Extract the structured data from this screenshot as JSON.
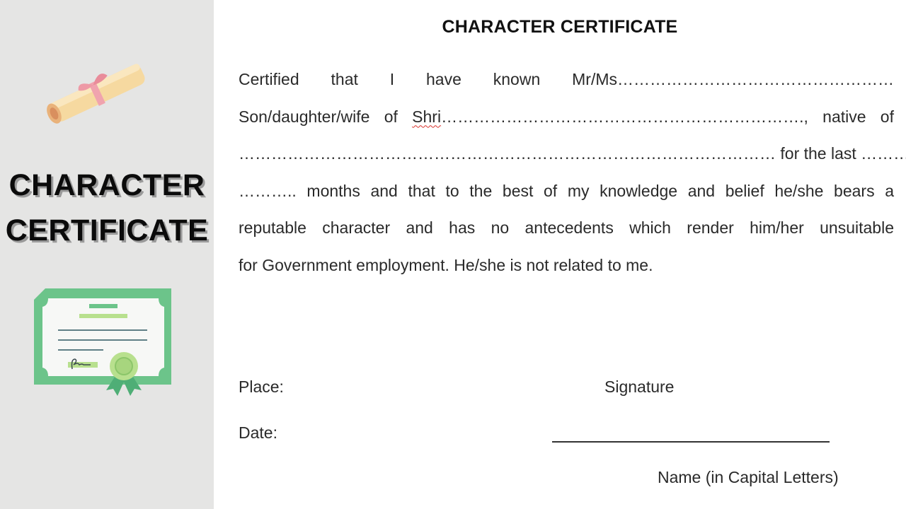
{
  "sidebar": {
    "title_line1": "CHARACTER",
    "title_line2": "CERTIFICATE",
    "icons": [
      "scroll-icon",
      "certificate-icon"
    ]
  },
  "document": {
    "title": "CHARACTER CERTIFICATE",
    "paragraph_lines": [
      {
        "parts": [
          "Certified that I have known Mr/Ms……………………………………………"
        ]
      },
      {
        "before": "Son/daughter/wife of ",
        "squiggle": "Shri",
        "after": "…………………………………………………………., native of"
      },
      {
        "parts": [
          "……………………………………………………………………………………… for the last ………… years"
        ]
      },
      {
        "parts": [
          "……….. months and that to the best of my knowledge and belief he/she bears a"
        ]
      },
      {
        "parts": [
          "reputable character and has no antecedents which render him/her unsuitable"
        ]
      },
      {
        "parts": [
          "for Government employment. He/she is not related to me."
        ]
      }
    ],
    "place_label": "Place:",
    "date_label": "Date:",
    "signature_label": "Signature",
    "name_label": "Name (in Capital Letters)"
  },
  "colors": {
    "sidebar_bg": "#e5e5e4",
    "certificate_green": "#6cc48a",
    "spellcheck_red": "#d9312b"
  }
}
